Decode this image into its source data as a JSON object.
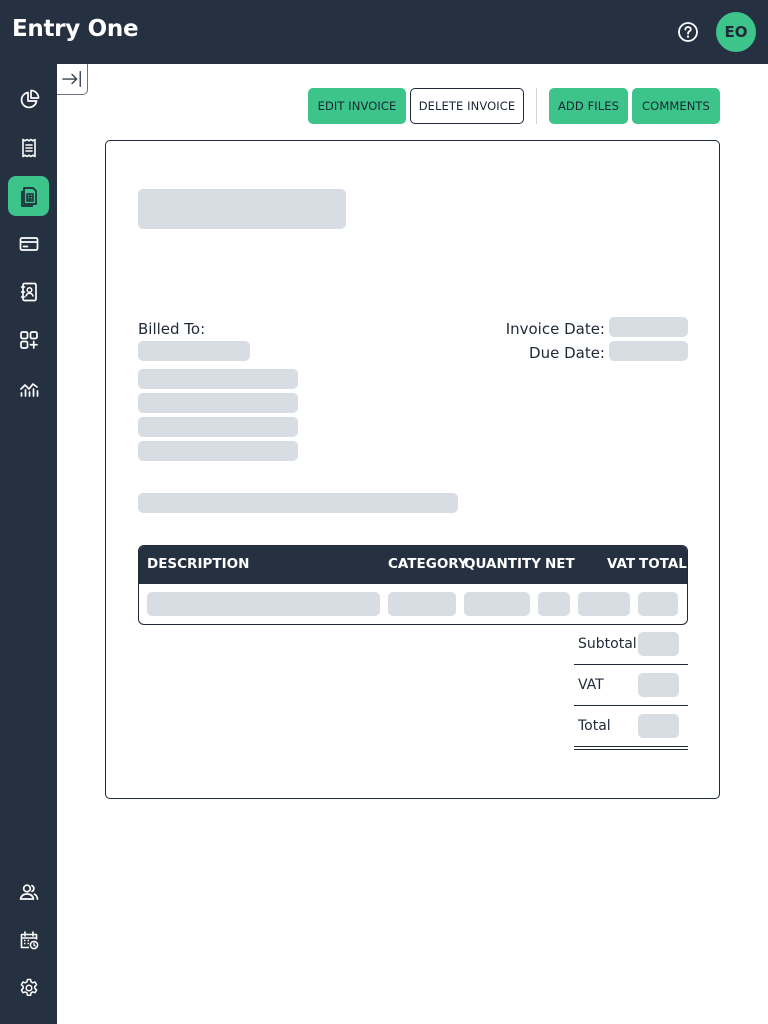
{
  "app": {
    "title": "Entry One",
    "avatar_initials": "EO",
    "accent_color": "#3cc48a",
    "nav_color": "#253141"
  },
  "header": {
    "help_icon": "help-circle-icon"
  },
  "sidebar": {
    "items": [
      {
        "icon": "pie-chart-icon",
        "active": false
      },
      {
        "icon": "receipt-icon",
        "active": false
      },
      {
        "icon": "invoice-icon",
        "active": true
      },
      {
        "icon": "credit-card-icon",
        "active": false
      },
      {
        "icon": "contact-book-icon",
        "active": false
      },
      {
        "icon": "apps-add-icon",
        "active": false
      },
      {
        "icon": "line-chart-icon",
        "active": false
      }
    ],
    "bottom_items": [
      {
        "icon": "users-icon"
      },
      {
        "icon": "calendar-clock-icon"
      },
      {
        "icon": "settings-gear-icon"
      }
    ]
  },
  "toolbar": {
    "edit_label": "EDIT INVOICE",
    "delete_label": "DELETE INVOICE",
    "add_files_label": "ADD FILES",
    "comments_label": "COMMENTS"
  },
  "invoice": {
    "billed_to_label": "Billed To:",
    "invoice_date_label": "Invoice Date:",
    "due_date_label": "Due Date:",
    "table": {
      "headers": [
        "DESCRIPTION",
        "CATEGORY",
        "QUANTITY",
        "NET",
        "VAT",
        "TOTAL"
      ]
    },
    "totals": {
      "subtotal_label": "Subtotal",
      "vat_label": "VAT",
      "total_label": "Total"
    }
  }
}
